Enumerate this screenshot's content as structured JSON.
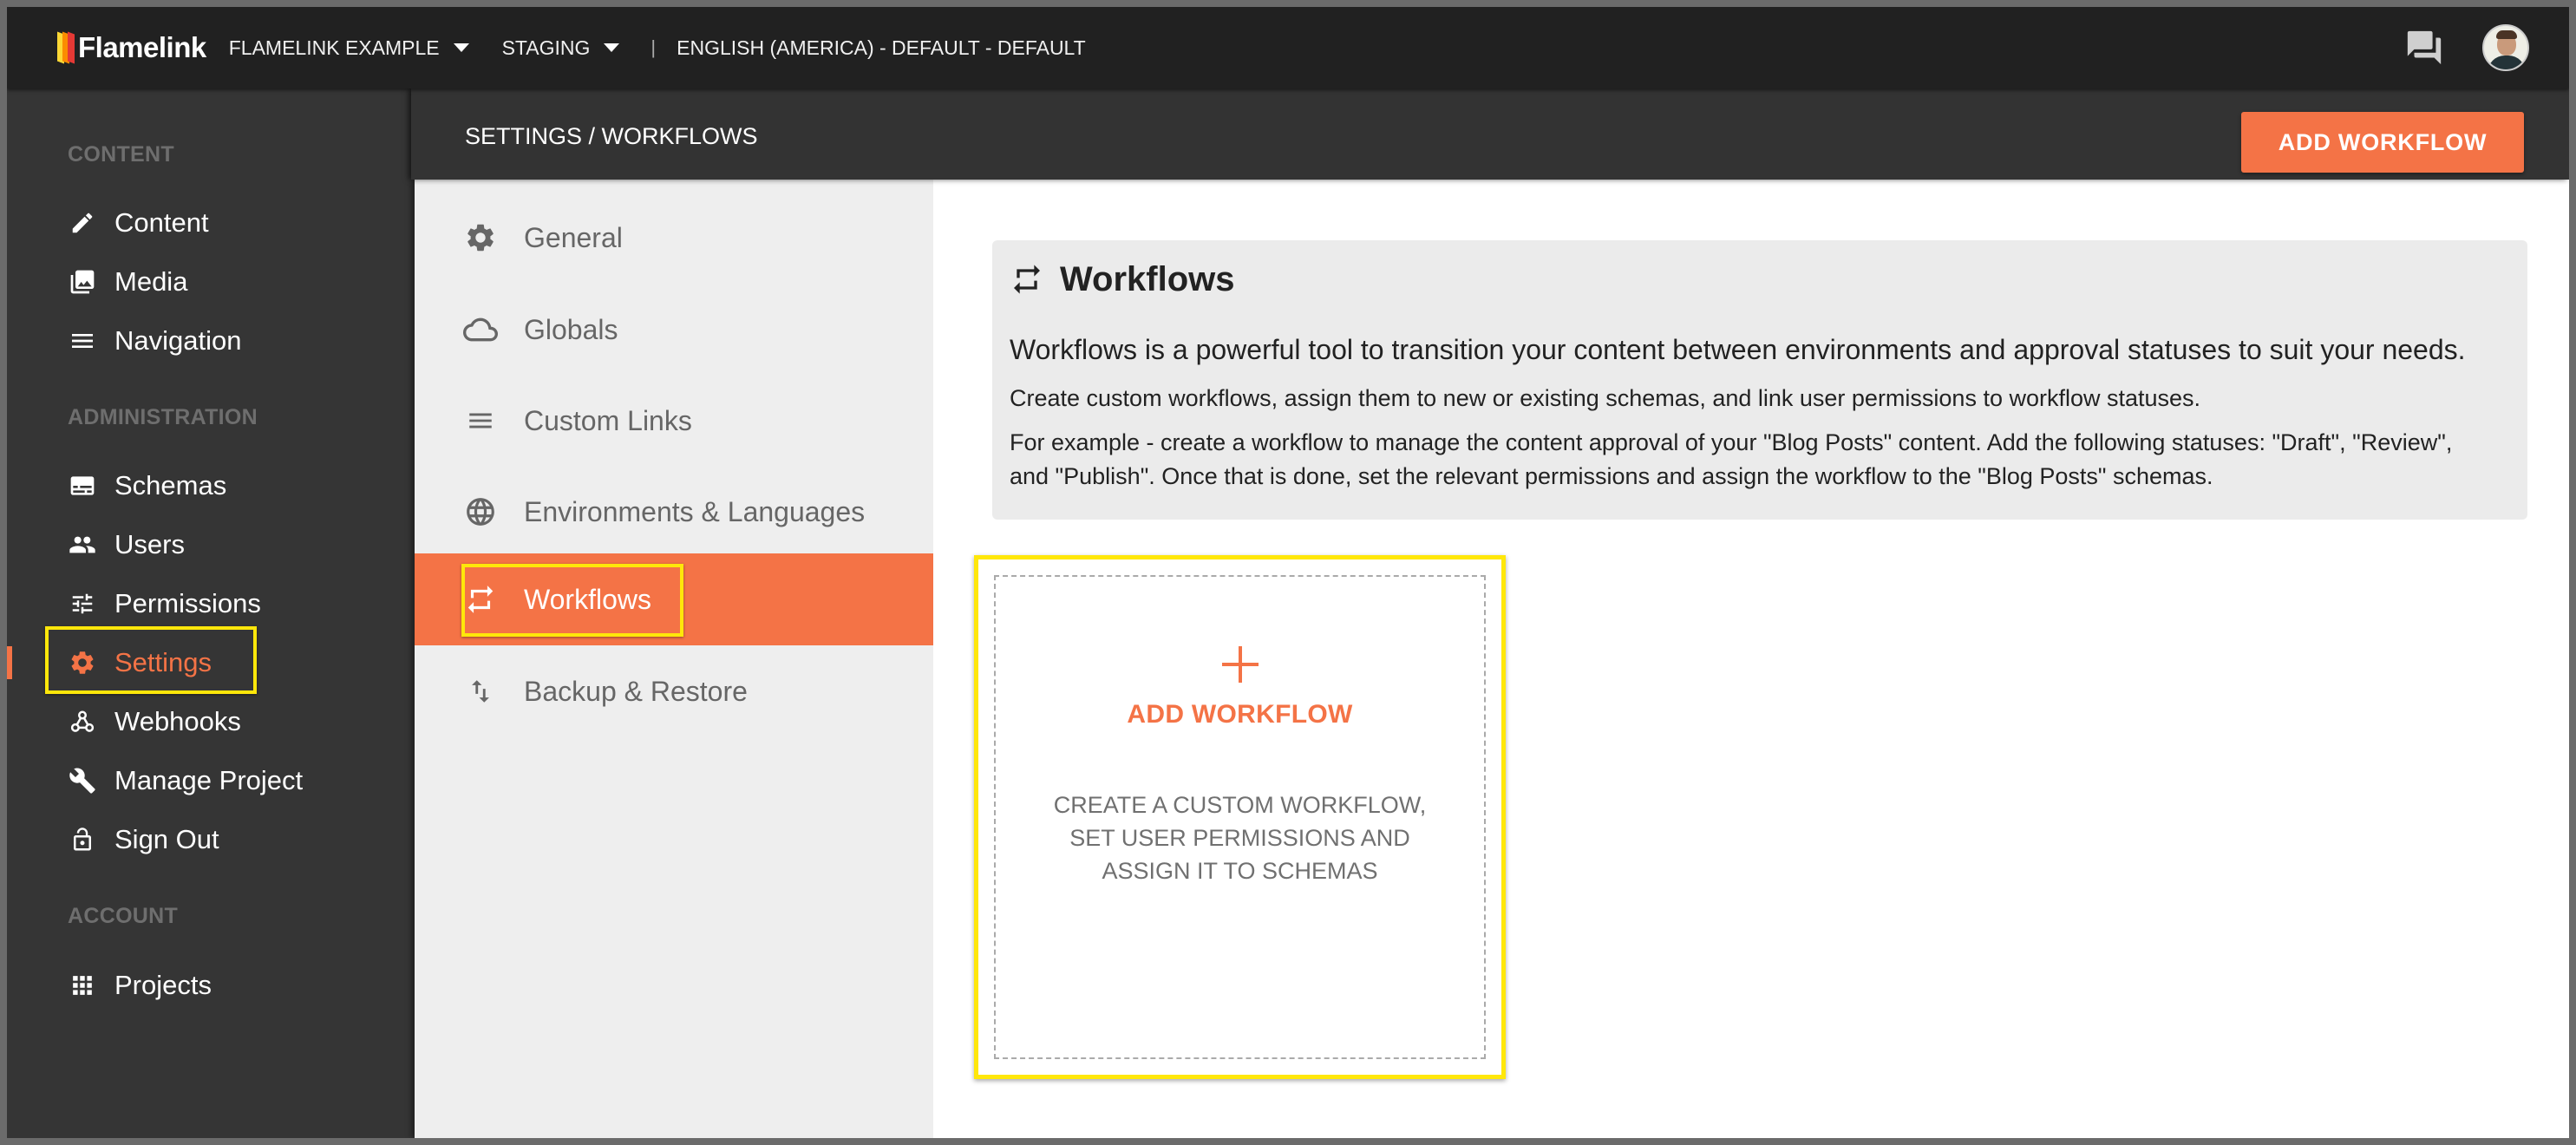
{
  "topbar": {
    "brand": "Flamelink",
    "project": "FLAMELINK EXAMPLE",
    "environment": "STAGING",
    "separator": "|",
    "locale": "ENGLISH (AMERICA) - DEFAULT - DEFAULT",
    "icons": [
      "chat-icon",
      "user-avatar"
    ],
    "logo_colors": [
      "#fdd835",
      "#fb8c00",
      "#e53935"
    ]
  },
  "sidebar": {
    "sections": [
      {
        "heading": "CONTENT",
        "items": [
          {
            "label": "Content",
            "icon": "pencil-icon"
          },
          {
            "label": "Media",
            "icon": "photo-library-icon"
          },
          {
            "label": "Navigation",
            "icon": "menu-icon"
          }
        ]
      },
      {
        "heading": "ADMINISTRATION",
        "items": [
          {
            "label": "Schemas",
            "icon": "schema-icon"
          },
          {
            "label": "Users",
            "icon": "people-icon"
          },
          {
            "label": "Permissions",
            "icon": "tune-icon"
          },
          {
            "label": "Settings",
            "icon": "gear-icon",
            "active": true
          },
          {
            "label": "Webhooks",
            "icon": "webhook-icon"
          },
          {
            "label": "Manage Project",
            "icon": "wrench-icon"
          },
          {
            "label": "Sign Out",
            "icon": "lock-open-icon"
          }
        ]
      },
      {
        "heading": "ACCOUNT",
        "items": [
          {
            "label": "Projects",
            "icon": "apps-grid-icon"
          }
        ]
      }
    ]
  },
  "header": {
    "breadcrumb": "SETTINGS / WORKFLOWS",
    "add_button": "ADD WORKFLOW"
  },
  "settings_menu": {
    "items": [
      {
        "label": "General",
        "icon": "gear-icon"
      },
      {
        "label": "Globals",
        "icon": "cloud-icon"
      },
      {
        "label": "Custom Links",
        "icon": "menu-icon"
      },
      {
        "label": "Environments & Languages",
        "icon": "globe-icon"
      },
      {
        "label": "Workflows",
        "icon": "repeat-icon",
        "active": true
      },
      {
        "label": "Backup & Restore",
        "icon": "import-export-icon"
      }
    ]
  },
  "info": {
    "title": "Workflows",
    "lead": "Workflows is a powerful tool to transition your content between environments and approval statuses to suit your needs.",
    "p1": "Create custom workflows, assign them to new or existing schemas, and link user permissions to workflow statuses.",
    "p2": "For example - create a workflow to manage the content approval of your \"Blog Posts\" content. Add the following statuses: \"Draft\", \"Review\", and \"Publish\". Once that is done, set the relevant permissions and assign the workflow to the \"Blog Posts\" schemas."
  },
  "add_card": {
    "title": "ADD WORKFLOW",
    "description": "CREATE A CUSTOM WORKFLOW, SET USER PERMISSIONS AND ASSIGN IT TO SCHEMAS"
  },
  "colors": {
    "accent": "#f47346",
    "highlight": "#ffe70a",
    "topbar": "#212121",
    "sidebar": "#353535"
  }
}
